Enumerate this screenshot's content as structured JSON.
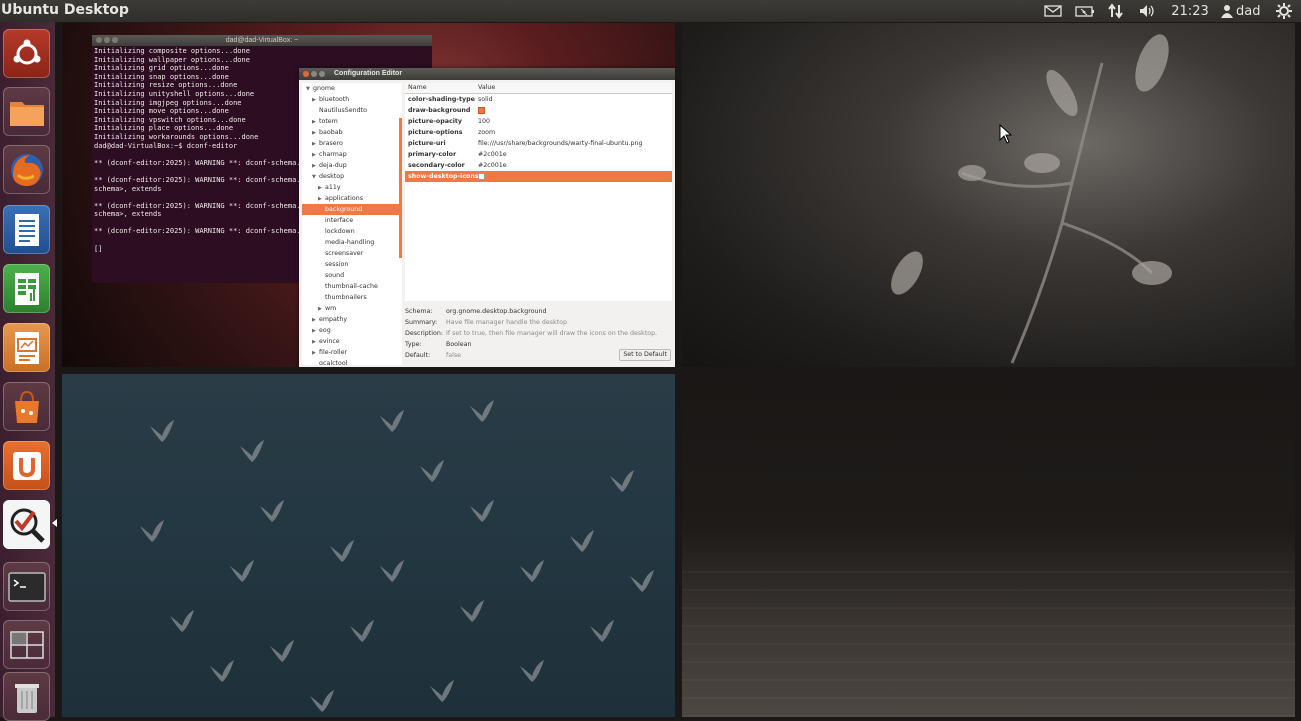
{
  "panel": {
    "title": "Ubuntu Desktop",
    "clock": "21:23",
    "user": "dad"
  },
  "launcher": {
    "items": [
      {
        "name": "Dash Home",
        "icon": "ubuntu-logo-icon",
        "color": "#c0392b"
      },
      {
        "name": "Files",
        "icon": "folder-icon",
        "color": "#e8782c"
      },
      {
        "name": "Firefox",
        "icon": "firefox-icon",
        "color": "#e66a1f"
      },
      {
        "name": "LibreOffice Writer",
        "icon": "writer-icon",
        "color": "#2b6cb0"
      },
      {
        "name": "LibreOffice Calc",
        "icon": "calc-icon",
        "color": "#3a9b3a"
      },
      {
        "name": "LibreOffice Impress",
        "icon": "impress-icon",
        "color": "#d9782c"
      },
      {
        "name": "Ubuntu Software Center",
        "icon": "software-center-icon",
        "color": "#e8782c"
      },
      {
        "name": "Ubuntu One",
        "icon": "ubuntu-one-icon",
        "color": "#e8602c"
      },
      {
        "name": "Search App",
        "icon": "magnifier-icon",
        "color": "#c0392b"
      },
      {
        "name": "Terminal",
        "icon": "terminal-icon",
        "color": "#333333"
      },
      {
        "name": "Workspace Switcher",
        "icon": "workspace-switcher-icon",
        "color": "#5a3a4a"
      },
      {
        "name": "Trash",
        "icon": "trash-icon",
        "color": "#9a9a9a"
      }
    ]
  },
  "terminal": {
    "title": "dad@dad-VirtualBox: ~",
    "lines": [
      "Initializing composite options...done",
      "Initializing wallpaper options...done",
      "Initializing grid options...done",
      "Initializing snap options...done",
      "Initializing resize options...done",
      "Initializing unityshell options...done",
      "Initializing imgjpeg options...done",
      "Initializing move options...done",
      "Initializing vpswitch options...done",
      "Initializing place options...done",
      "Initializing workarounds options...done",
      "dad@dad-VirtualBox:~$ dconf-editor",
      "",
      "** (dconf-editor:2025): WARNING **: dconf-schema.",
      "",
      "** (dconf-editor:2025): WARNING **: dconf-schema.",
      "schema>, extends",
      "",
      "** (dconf-editor:2025): WARNING **: dconf-schema.",
      "schema>, extends",
      "",
      "** (dconf-editor:2025): WARNING **: dconf-schema.",
      "",
      "[]"
    ]
  },
  "config_editor": {
    "title": "Configuration Editor",
    "tree": [
      {
        "label": "gnome",
        "depth": 0,
        "arrow": "▼"
      },
      {
        "label": "bluetooth",
        "depth": 1,
        "arrow": "▶"
      },
      {
        "label": "NautilusSendto",
        "depth": 1,
        "arrow": ""
      },
      {
        "label": "totem",
        "depth": 1,
        "arrow": "▶"
      },
      {
        "label": "baobab",
        "depth": 1,
        "arrow": "▶"
      },
      {
        "label": "brasero",
        "depth": 1,
        "arrow": "▶"
      },
      {
        "label": "charmap",
        "depth": 1,
        "arrow": "▶"
      },
      {
        "label": "deja-dup",
        "depth": 1,
        "arrow": "▶"
      },
      {
        "label": "desktop",
        "depth": 1,
        "arrow": "▼"
      },
      {
        "label": "a11y",
        "depth": 2,
        "arrow": "▶"
      },
      {
        "label": "applications",
        "depth": 2,
        "arrow": "▶"
      },
      {
        "label": "background",
        "depth": 2,
        "arrow": "",
        "selected": true
      },
      {
        "label": "interface",
        "depth": 2,
        "arrow": ""
      },
      {
        "label": "lockdown",
        "depth": 2,
        "arrow": ""
      },
      {
        "label": "media-handling",
        "depth": 2,
        "arrow": ""
      },
      {
        "label": "screensaver",
        "depth": 2,
        "arrow": ""
      },
      {
        "label": "session",
        "depth": 2,
        "arrow": ""
      },
      {
        "label": "sound",
        "depth": 2,
        "arrow": ""
      },
      {
        "label": "thumbnail-cache",
        "depth": 2,
        "arrow": ""
      },
      {
        "label": "thumbnailers",
        "depth": 2,
        "arrow": ""
      },
      {
        "label": "wm",
        "depth": 2,
        "arrow": "▶"
      },
      {
        "label": "empathy",
        "depth": 1,
        "arrow": "▶"
      },
      {
        "label": "eog",
        "depth": 1,
        "arrow": "▶"
      },
      {
        "label": "evince",
        "depth": 1,
        "arrow": "▶"
      },
      {
        "label": "file-roller",
        "depth": 1,
        "arrow": "▶"
      },
      {
        "label": "gcalctool",
        "depth": 1,
        "arrow": ""
      }
    ],
    "columns": {
      "name": "Name",
      "value": "Value"
    },
    "keys": [
      {
        "key": "color-shading-type",
        "value": "solid"
      },
      {
        "key": "draw-background",
        "value": "",
        "checkbox": true,
        "checked": true
      },
      {
        "key": "picture-opacity",
        "value": "100"
      },
      {
        "key": "picture-options",
        "value": "zoom"
      },
      {
        "key": "picture-uri",
        "value": "file:///usr/share/backgrounds/warty-final-ubuntu.png"
      },
      {
        "key": "primary-color",
        "value": "#2c001e"
      },
      {
        "key": "secondary-color",
        "value": "#2c001e"
      },
      {
        "key": "show-desktop-icons",
        "value": "",
        "checkbox": true,
        "checked": false,
        "selected": true
      }
    ],
    "info": {
      "schema_label": "Schema:",
      "schema": "org.gnome.desktop.background",
      "summary_label": "Summary:",
      "summary": "Have file manager handle the desktop",
      "description_label": "Description:",
      "description": "If set to true, then file manager will draw the icons on the desktop.",
      "type_label": "Type:",
      "type": "Boolean",
      "default_label": "Default:",
      "default": "false",
      "set_default": "Set to Default"
    }
  },
  "colors": {
    "accent": "#f07746",
    "launcher": "#4a2a38",
    "panel": "#3c3b37"
  }
}
